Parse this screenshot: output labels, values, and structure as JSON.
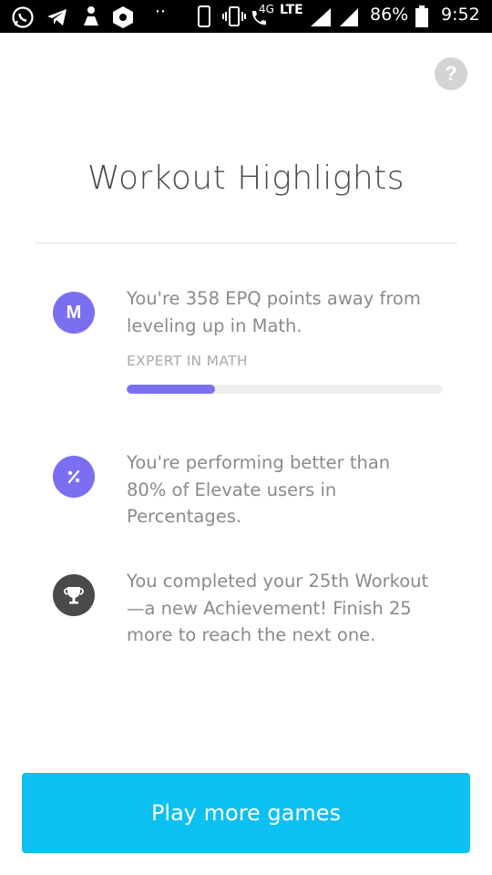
{
  "status_bar": {
    "network": "4G",
    "lte": "LTE",
    "battery": "86%",
    "time": "9:52",
    "icons": [
      "whatsapp-icon",
      "telegram-icon",
      "app-icon",
      "shield-icon",
      "more-icon",
      "phone-icon",
      "vibrate-icon",
      "call-icon",
      "signal-icon",
      "signal-icon",
      "battery-icon"
    ]
  },
  "help": {
    "label": "?"
  },
  "page_title": "Workout Highlights",
  "highlights": [
    {
      "icon": "M",
      "icon_color": "#7b6ff0",
      "text": "You're 358 EPQ points away from leveling up in Math.",
      "progress_caption": "EXPERT IN MATH",
      "progress_fraction": 0.28
    },
    {
      "icon": "percent-icon",
      "icon_color": "#7b6ff0",
      "text": "You're performing better than 80% of Elevate users in Percentages."
    },
    {
      "icon": "trophy-icon",
      "icon_color": "#4a4a4a",
      "text": "You completed your 25th Workout —a new Achievement! Finish 25 more to reach the next one."
    }
  ],
  "primary_action": {
    "label": "Play more games",
    "color": "#0cc0f2"
  }
}
